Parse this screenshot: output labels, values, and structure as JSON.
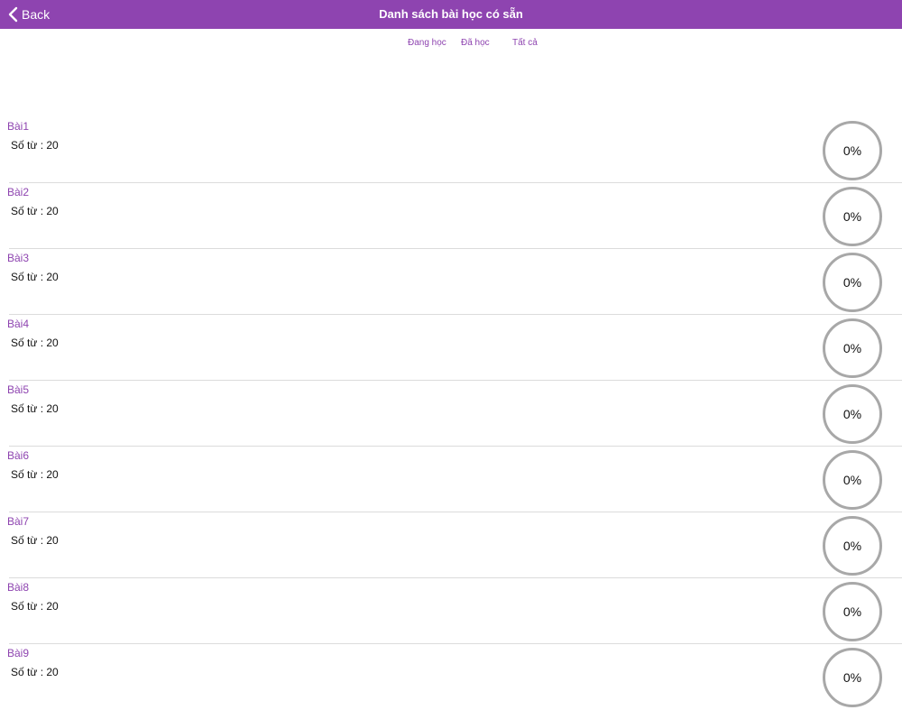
{
  "header": {
    "back_label": "Back",
    "title": "Danh sách bài học có sẵn",
    "background": "#8e44b0",
    "back_icon": "chevron-left-icon"
  },
  "tabs": [
    {
      "label": "Đang học"
    },
    {
      "label": "Đã học"
    },
    {
      "label": "Tất cả"
    }
  ],
  "accent_color": "#8e44b0",
  "lessons": [
    {
      "title": "Bài1",
      "words": "Số từ : 20",
      "progress": "0%"
    },
    {
      "title": "Bài2",
      "words": "Số từ : 20",
      "progress": "0%"
    },
    {
      "title": "Bài3",
      "words": "Số từ : 20",
      "progress": "0%"
    },
    {
      "title": "Bài4",
      "words": "Số từ : 20",
      "progress": "0%"
    },
    {
      "title": "Bài5",
      "words": "Số từ : 20",
      "progress": "0%"
    },
    {
      "title": "Bài6",
      "words": "Số từ : 20",
      "progress": "0%"
    },
    {
      "title": "Bài7",
      "words": "Số từ : 20",
      "progress": "0%"
    },
    {
      "title": "Bài8",
      "words": "Số từ : 20",
      "progress": "0%"
    },
    {
      "title": "Bài9",
      "words": "Số từ : 20",
      "progress": "0%"
    }
  ]
}
